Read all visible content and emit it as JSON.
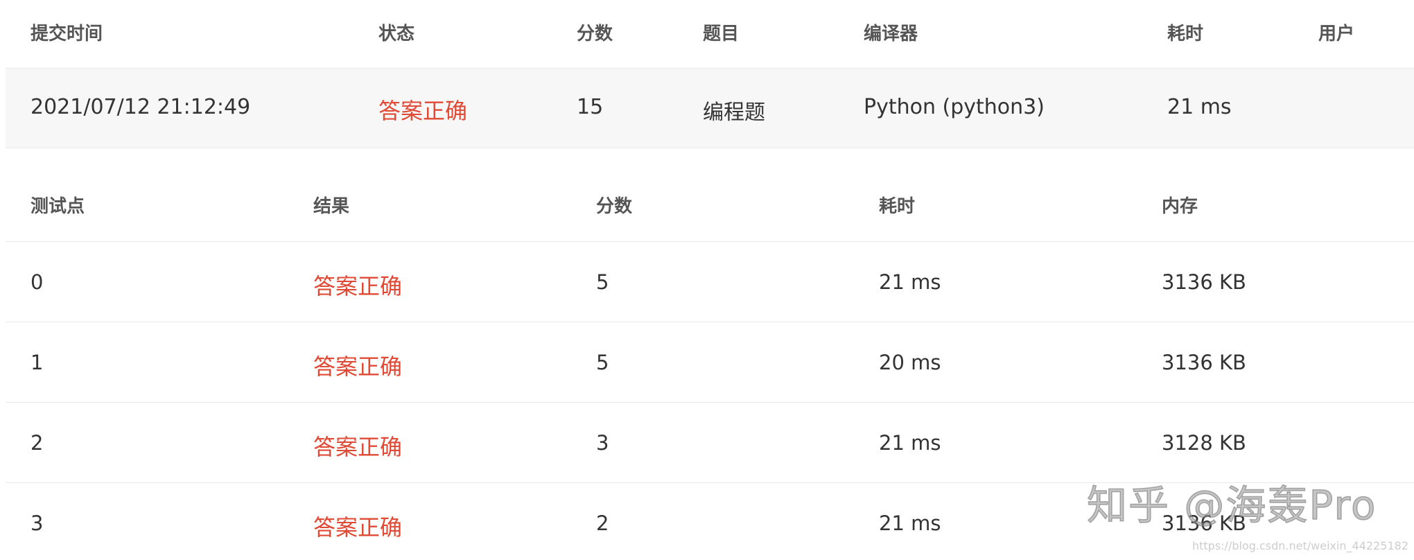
{
  "summary": {
    "headers": {
      "submit_time": "提交时间",
      "status": "状态",
      "score": "分数",
      "problem": "题目",
      "compiler": "编译器",
      "time": "耗时",
      "user": "用户"
    },
    "row": {
      "submit_time": "2021/07/12 21:12:49",
      "status": "答案正确",
      "score": "15",
      "problem": "编程题",
      "compiler": "Python (python3)",
      "time": "21 ms",
      "user": ""
    }
  },
  "tests": {
    "headers": {
      "test_point": "测试点",
      "result": "结果",
      "score": "分数",
      "time": "耗时",
      "memory": "内存"
    },
    "rows": [
      {
        "test_point": "0",
        "result": "答案正确",
        "score": "5",
        "time": "21 ms",
        "memory": "3136 KB"
      },
      {
        "test_point": "1",
        "result": "答案正确",
        "score": "5",
        "time": "20 ms",
        "memory": "3136 KB"
      },
      {
        "test_point": "2",
        "result": "答案正确",
        "score": "3",
        "time": "21 ms",
        "memory": "3128 KB"
      },
      {
        "test_point": "3",
        "result": "答案正确",
        "score": "2",
        "time": "21 ms",
        "memory": "3136 KB"
      }
    ]
  },
  "watermark": {
    "text": "知乎 @海轰Pro",
    "url": "https://blog.csdn.net/weixin_44225182"
  },
  "colors": {
    "accepted": "#e04a35",
    "row_highlight": "#f7f7f7",
    "border": "#e9e9e9"
  }
}
